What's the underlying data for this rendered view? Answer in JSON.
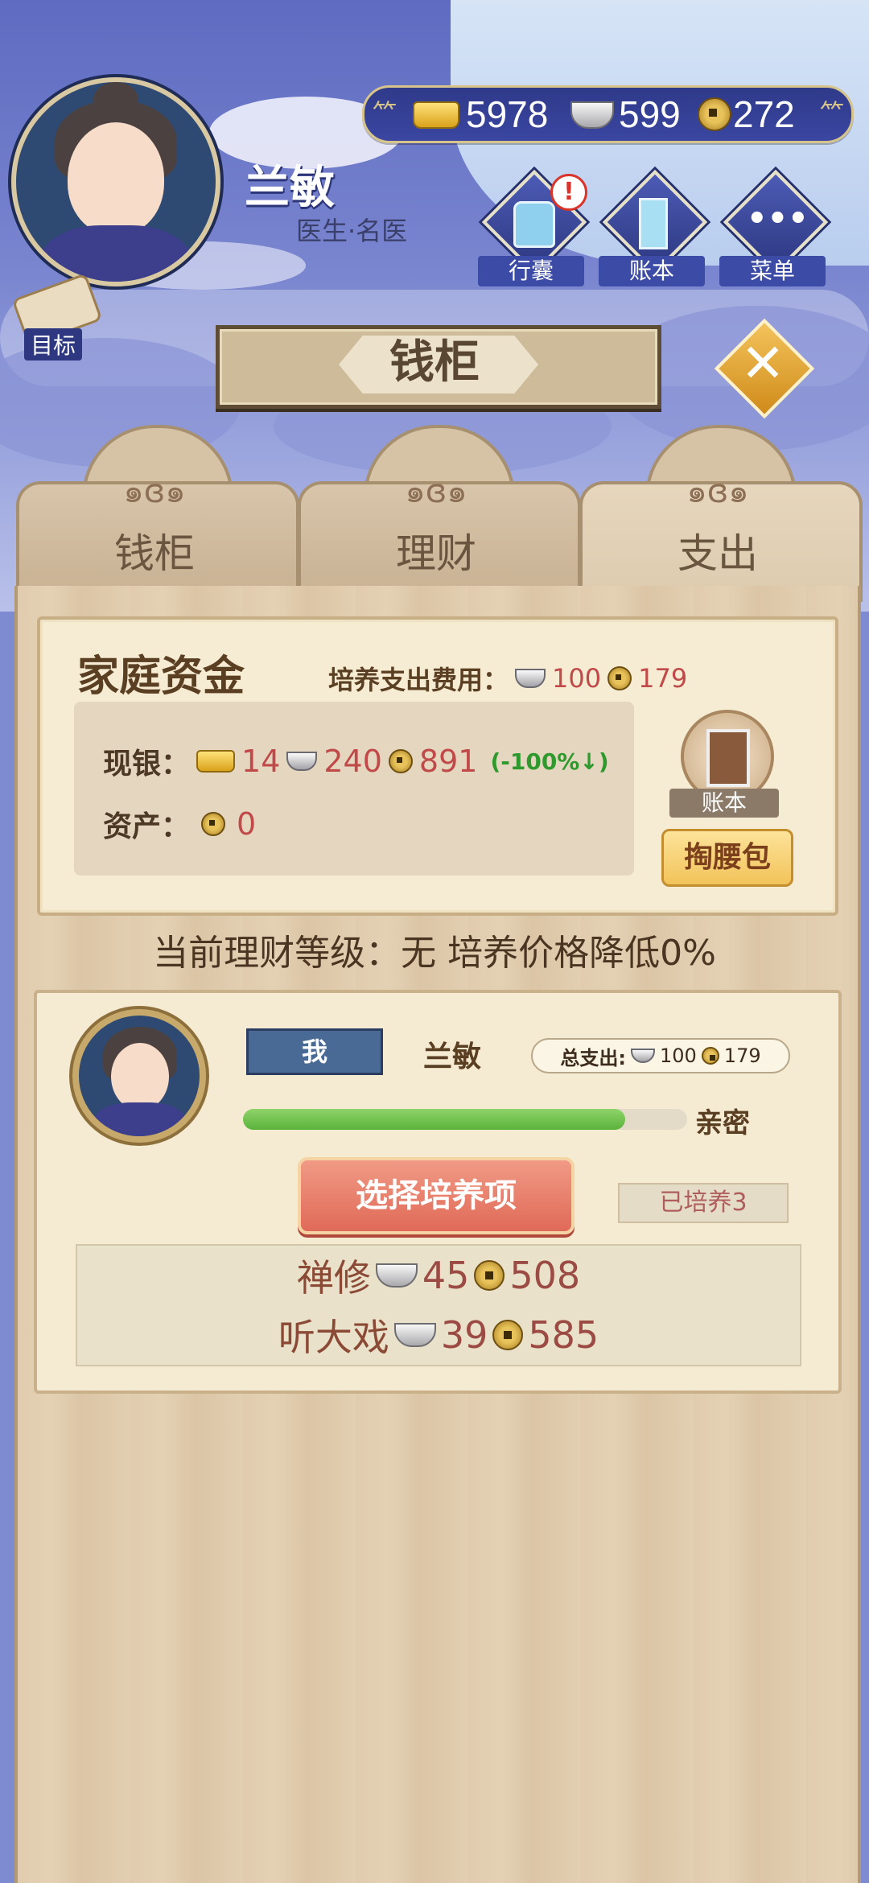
{
  "currency": {
    "gold": "5978",
    "silver": "599",
    "coin": "272"
  },
  "profile": {
    "name": "兰敏",
    "title": "医生·名医"
  },
  "top_buttons": {
    "bag": "行囊",
    "ledger": "账本",
    "menu": "菜单",
    "alert": "!"
  },
  "goal": {
    "label": "目标"
  },
  "header": {
    "title": "钱柜",
    "close": "✕"
  },
  "tabs": [
    {
      "label": "钱柜"
    },
    {
      "label": "理财"
    },
    {
      "label": "支出"
    }
  ],
  "funds": {
    "title": "家庭资金",
    "cost_label": "培养支出费用：",
    "cost_silver": "100",
    "cost_coin": "179",
    "cash_label": "现银：",
    "cash_gold": "14",
    "cash_silver": "240",
    "cash_coin": "891",
    "cash_change": "(-100%↓)",
    "assets_label": "资产：",
    "assets_coin": "0",
    "ledger_label": "账本",
    "purse_button": "掏腰包"
  },
  "level_text": "当前理财等级：无 培养价格降低0%",
  "member": {
    "me_badge": "我",
    "name": "兰敏",
    "total_label": "总支出:",
    "total_silver": "100",
    "total_coin": "179",
    "intimacy_label": "亲密",
    "intimacy_progress": 0.86,
    "select_button": "选择培养项",
    "trained": "已培养3",
    "items": [
      {
        "name": "禅修",
        "silver": "45",
        "coin": "508"
      },
      {
        "name": "听大戏",
        "silver": "39",
        "coin": "585"
      }
    ]
  },
  "colors": {
    "accent_blue": "#3c4ba5",
    "red_text": "#c04949",
    "bar_green": "#5ab33b",
    "select_button": "#e06a58"
  }
}
